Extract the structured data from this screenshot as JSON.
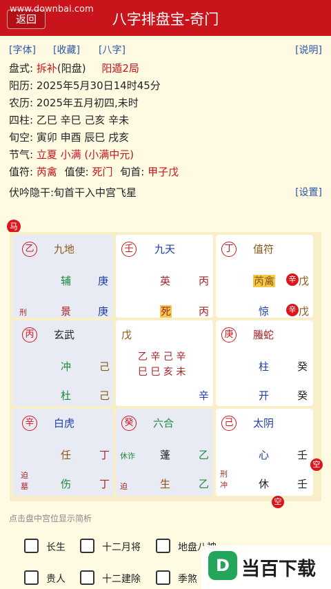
{
  "header": {
    "back_label": "返回",
    "title": "八字排盘宝-奇门",
    "watermark": "www.downbai.com"
  },
  "links": {
    "font": "[字体]",
    "favorite": "[收藏]",
    "bazi": "[八字]",
    "help": "[说明]",
    "settings": "[设置]"
  },
  "info": {
    "panshi_label": "盘式:",
    "panshi_method": "拆补",
    "panshi_type": "(阳盘)",
    "panshi_dun": "阳遁2局",
    "solar": "阳历: 2025年5月30日14时45分",
    "lunar": "农历: 2025年五月初四,未时",
    "sizhu": "四柱: 乙巳  辛巳  己亥  辛未",
    "xunkong": "旬空: 寅卯  申酉  辰巳  戌亥",
    "jieqi_label": "节气:",
    "jieqi_value": "立夏 小满  (小满中元)",
    "zhifu_label": "值符:",
    "zhifu_value": "芮禽",
    "zhishi_label": "值使:",
    "zhishi_value": "死门",
    "xunshou_label": "旬首:",
    "xunshou_value": "甲子戊",
    "fuyin": "伏吟隐干:旬首干入中宫飞星"
  },
  "badges": {
    "horse": "马",
    "kong": "空"
  },
  "palaces": [
    {
      "stem": "乙",
      "god": "九地",
      "star": "辅",
      "star_stem": "庚",
      "door": "景",
      "door_stem": "庚",
      "tag1": "刑",
      "tag2": ""
    },
    {
      "stem": "壬",
      "god": "九天",
      "star": "英",
      "star_stem": "丙",
      "door": "死",
      "door_stem": "丙",
      "tag1": "",
      "tag2": ""
    },
    {
      "stem": "丁",
      "god": "值符",
      "star": "芮禽",
      "star_ball": "辛",
      "star_stem": "戊",
      "door": "惊",
      "door_ball": "辛",
      "door_stem": "戊",
      "tag1": "",
      "tag2": ""
    },
    {
      "stem": "丙",
      "god": "玄武",
      "star": "冲",
      "star_stem": "己",
      "door": "杜",
      "door_stem": "己",
      "tag1": "",
      "tag2": ""
    },
    {
      "stem": "戊",
      "center_row1": "乙 辛 己 辛",
      "center_row2": "巳 巳 亥 未",
      "center_stem": "辛"
    },
    {
      "stem": "庚",
      "god": "螣蛇",
      "star": "柱",
      "star_stem": "癸",
      "door": "开",
      "door_stem": "癸",
      "tag1": "",
      "tag2": ""
    },
    {
      "stem": "辛",
      "god": "白虎",
      "star": "任",
      "star_stem": "丁",
      "door": "伤",
      "door_stem": "丁",
      "tag1": "迫",
      "tag2": "墓"
    },
    {
      "stem": "癸",
      "god": "六合",
      "star": "蓬",
      "star_stem": "乙",
      "door": "生",
      "door_stem": "乙",
      "tag1": "休诈",
      "tag2": "迫"
    },
    {
      "stem": "己",
      "god": "太阴",
      "star": "心",
      "star_stem": "壬",
      "door": "休",
      "door_stem": "壬",
      "tag1": "刑",
      "tag2": "冲"
    }
  ],
  "hint": "点击盘中宫位显示简析",
  "options": {
    "row1": [
      "长生",
      "十二月将",
      "地盘八神"
    ],
    "row2": [
      "贵人",
      "十二建除",
      "季煞"
    ]
  },
  "brand": {
    "logo_letter": "D",
    "text": "当百下载"
  }
}
